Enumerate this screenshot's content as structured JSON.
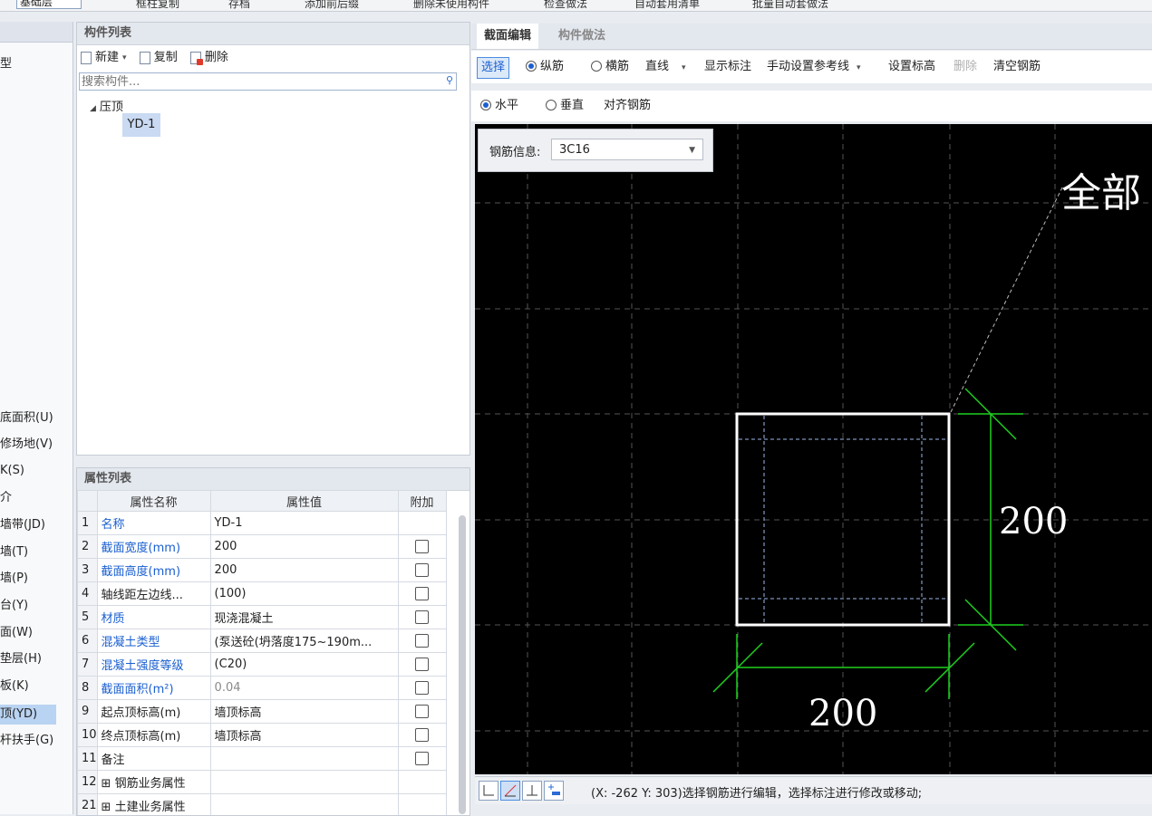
{
  "topbar": {
    "floor_value": "基础层",
    "items": [
      "框柱复制",
      "存档",
      "添加前后缀",
      "删除未使用构件",
      "检查做法",
      "自动套用清单",
      "批量自动套做法"
    ]
  },
  "left_nav": {
    "items": [
      {
        "label": "型",
        "selected": false
      },
      {
        "label": "底面积(U)",
        "selected": false
      },
      {
        "label": "修场地(V)",
        "selected": false
      },
      {
        "label": "K(S)",
        "selected": false
      },
      {
        "label": "介",
        "selected": false
      },
      {
        "label": "墙带(JD)",
        "selected": false
      },
      {
        "label": "墙(T)",
        "selected": false
      },
      {
        "label": "墙(P)",
        "selected": false
      },
      {
        "label": "台(Y)",
        "selected": false
      },
      {
        "label": "面(W)",
        "selected": false
      },
      {
        "label": "垫层(H)",
        "selected": false
      },
      {
        "label": "板(K)",
        "selected": false
      },
      {
        "label": "顶(YD)",
        "selected": true
      },
      {
        "label": "杆扶手(G)",
        "selected": false
      }
    ]
  },
  "component_list": {
    "title": "构件列表",
    "buttons": {
      "new": "新建",
      "copy": "复制",
      "delete": "删除"
    },
    "search_placeholder": "搜索构件...",
    "tree_root": "压顶",
    "tree_leaf": "YD-1"
  },
  "property_list": {
    "title": "属性列表",
    "headers": [
      "属性名称",
      "属性值",
      "附加"
    ],
    "rows": [
      {
        "n": "1",
        "name": "名称",
        "value": "YD-1",
        "style": "blue",
        "checkbox": false
      },
      {
        "n": "2",
        "name": "截面宽度(mm)",
        "value": "200",
        "style": "blue",
        "checkbox": true
      },
      {
        "n": "3",
        "name": "截面高度(mm)",
        "value": "200",
        "style": "blue",
        "checkbox": true
      },
      {
        "n": "4",
        "name": "轴线距左边线...",
        "value": "(100)",
        "style": "normal",
        "checkbox": true
      },
      {
        "n": "5",
        "name": "材质",
        "value": "现浇混凝土",
        "style": "blue",
        "checkbox": true
      },
      {
        "n": "6",
        "name": "混凝土类型",
        "value": "(泵送砼(坍落度175~190m...",
        "style": "blue",
        "checkbox": true
      },
      {
        "n": "7",
        "name": "混凝土强度等级",
        "value": "(C20)",
        "style": "blue",
        "checkbox": true
      },
      {
        "n": "8",
        "name": "截面面积(m²)",
        "value": "0.04",
        "style": "blue-grey",
        "checkbox": true
      },
      {
        "n": "9",
        "name": "起点顶标高(m)",
        "value": "墙顶标高",
        "style": "normal",
        "checkbox": true
      },
      {
        "n": "10",
        "name": "终点顶标高(m)",
        "value": "墙顶标高",
        "style": "normal",
        "checkbox": true
      },
      {
        "n": "11",
        "name": "备注",
        "value": "",
        "style": "normal",
        "checkbox": true
      },
      {
        "n": "12",
        "name": "⊞ 钢筋业务属性",
        "value": "",
        "style": "normal",
        "checkbox": false
      },
      {
        "n": "21",
        "name": "⊞ 土建业务属性",
        "value": "",
        "style": "normal",
        "checkbox": false
      }
    ]
  },
  "section_editor": {
    "tabs": [
      "截面编辑",
      "构件做法"
    ],
    "toolbar1": {
      "select": "选择",
      "longitudinal": "纵筋",
      "transverse": "横筋",
      "line": "直线",
      "show_label": "显示标注",
      "manual_ref": "手动设置参考线",
      "set_elev": "设置标高",
      "delete": "删除",
      "clear": "清空钢筋"
    },
    "toolbar2": {
      "horizontal": "水平",
      "vertical": "垂直",
      "align": "对齐钢筋"
    },
    "rebar_info_label": "钢筋信息:",
    "rebar_info_value": "3C16",
    "canvas_label_all": "全部",
    "dim_height": "200",
    "dim_width": "200",
    "status": "(X: -262 Y: 303)选择钢筋进行编辑，选择标注进行修改或移动;"
  }
}
